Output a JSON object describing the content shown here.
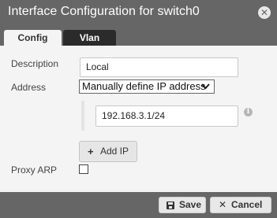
{
  "dialog": {
    "title": "Interface Configuration for switch0",
    "close_glyph": "✕"
  },
  "tabs": [
    {
      "label": "Config",
      "active": true
    },
    {
      "label": "Vlan",
      "active": false
    }
  ],
  "form": {
    "description_label": "Description",
    "description_value": "Local",
    "address_label": "Address",
    "address_mode": "Manually define IP address",
    "ip_addresses": [
      "192.168.3.1/24"
    ],
    "add_ip_label": "Add IP",
    "proxy_arp_label": "Proxy ARP",
    "proxy_arp_checked": false
  },
  "footer": {
    "save_label": "Save",
    "cancel_label": "Cancel"
  },
  "icons": {
    "close": "close-icon",
    "info": "info-icon",
    "add": "plus-icon",
    "save": "floppy-disk-icon",
    "cancel": "x-icon",
    "dropdown": "chevron-down-icon"
  },
  "colors": {
    "header": "#666666",
    "active_tab": "#f4f4f4",
    "inactive_tab": "#2b2b2b",
    "panel": "#f4f4f4"
  }
}
